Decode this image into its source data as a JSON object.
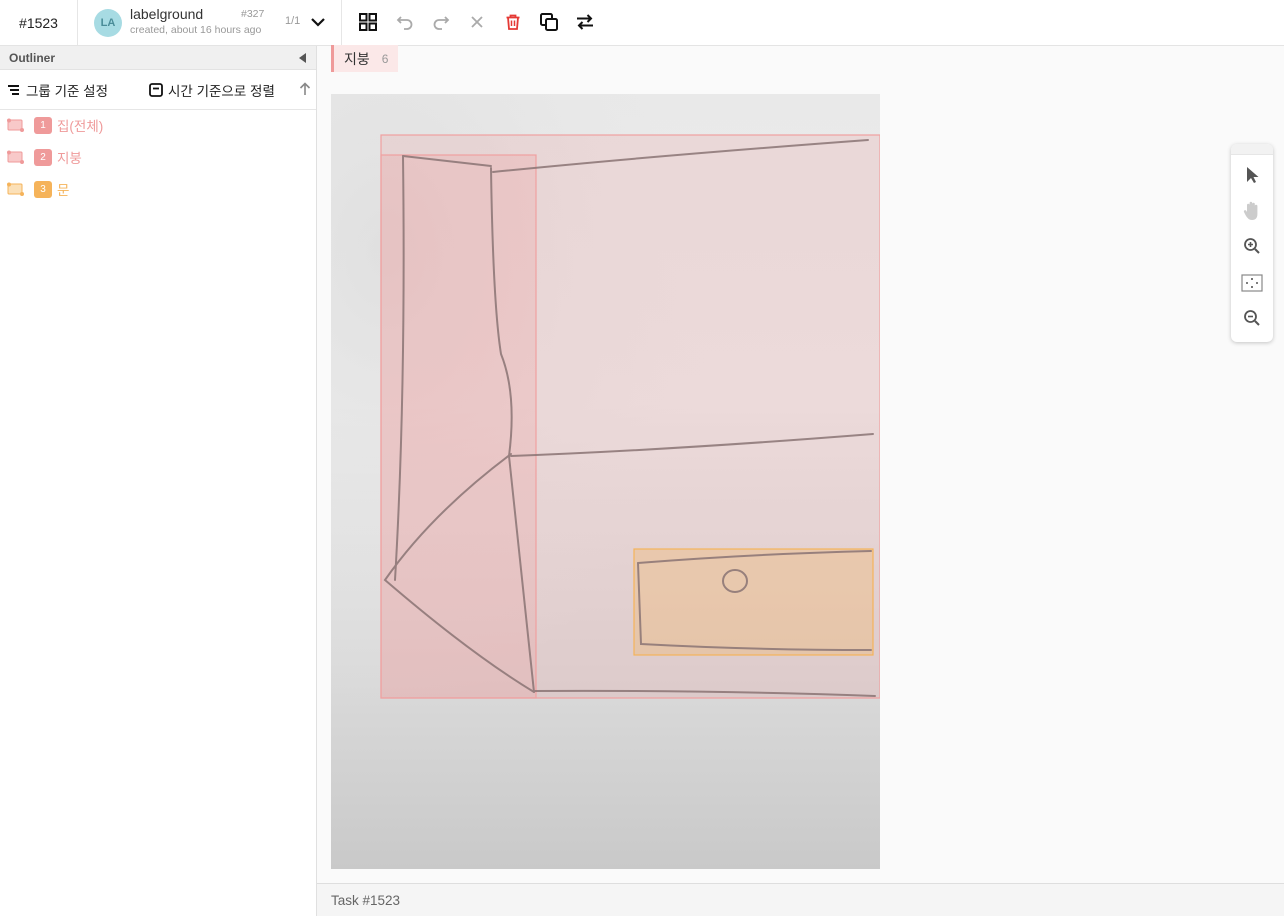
{
  "header": {
    "task_id": "#1523",
    "avatar_initials": "LA",
    "username": "labelground",
    "created": "created, about 16 hours ago",
    "job_id": "#327",
    "page_count": "1/1"
  },
  "toolbar": {
    "icons": [
      "grid-view-icon",
      "undo-icon",
      "redo-icon",
      "close-icon",
      "trash-icon",
      "copy-icon",
      "swap-icon"
    ],
    "delete_color": "#e53935"
  },
  "sidebar": {
    "title": "Outliner",
    "group_label": "그룹 기준 설정",
    "sort_label": "시간 기준으로 정렬",
    "objects": [
      {
        "index": "1",
        "name": "집(전체)",
        "color": "#ef9a9a"
      },
      {
        "index": "2",
        "name": "지붕",
        "color": "#ef9a9a"
      },
      {
        "index": "3",
        "name": "문",
        "color": "#f5b35a"
      }
    ]
  },
  "label_chip": {
    "name": "지붕",
    "count": "6"
  },
  "zoom_tools": [
    "pointer-icon",
    "hand-icon",
    "zoom-in-icon",
    "fit-icon",
    "zoom-out-icon"
  ],
  "footer": {
    "task_label": "Task #1523"
  }
}
